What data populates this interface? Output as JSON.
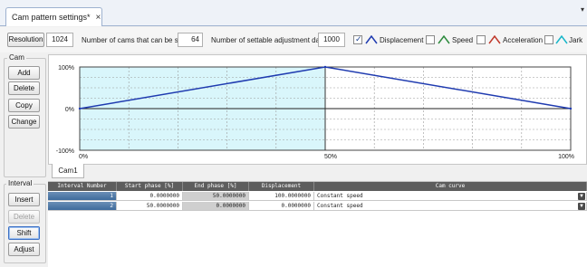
{
  "tab": {
    "title": "Cam pattern settings*",
    "close": "×",
    "menu": "▾"
  },
  "settings": {
    "resolution_button": "Resolution",
    "resolution_value": "1024",
    "cams_label": "Number of cams that can be set",
    "cams_value": "64",
    "adjust_label": "Number of settable adjustment data",
    "adjust_value": "1000",
    "legend": [
      {
        "label": "Displacement",
        "checked": true,
        "color": "#1f3bb0"
      },
      {
        "label": "Speed",
        "checked": false,
        "color": "#2e8b3e"
      },
      {
        "label": "Acceleration",
        "checked": false,
        "color": "#c0392b"
      },
      {
        "label": "Jark",
        "checked": false,
        "color": "#18b6c9"
      }
    ]
  },
  "cam_group": {
    "title": "Cam",
    "buttons": [
      "Add",
      "Delete",
      "Copy",
      "Change"
    ]
  },
  "interval_group": {
    "title": "Interval",
    "buttons": [
      "Insert",
      "Delete",
      "Shift",
      "Adjust"
    ]
  },
  "chart_data": {
    "type": "line",
    "y_tick_labels": [
      "100%",
      "0%",
      "-100%"
    ],
    "x_tick_labels": [
      "0%",
      "50%",
      "100%"
    ],
    "xlim": [
      0,
      100
    ],
    "ylim": [
      -100,
      100
    ],
    "grid": true,
    "series": [
      {
        "name": "Displacement",
        "color": "#1f3bb0",
        "x": [
          0,
          50,
          100
        ],
        "y": [
          0,
          100,
          0
        ]
      }
    ],
    "highlight_x_range": [
      0,
      50
    ]
  },
  "cam_tab": "Cam1",
  "table": {
    "headers": [
      "Interval Number",
      "Start phase [%]",
      "End phase [%]",
      "Displacement",
      "Cam curve"
    ],
    "rows": [
      {
        "num": "1",
        "start": "0.0000000",
        "end": "50.0000000",
        "disp": "100.0000000",
        "curve": "Constant speed"
      },
      {
        "num": "2",
        "start": "50.0000000",
        "end": "0.0000000",
        "disp": "0.0000000",
        "curve": "Constant speed"
      }
    ]
  }
}
